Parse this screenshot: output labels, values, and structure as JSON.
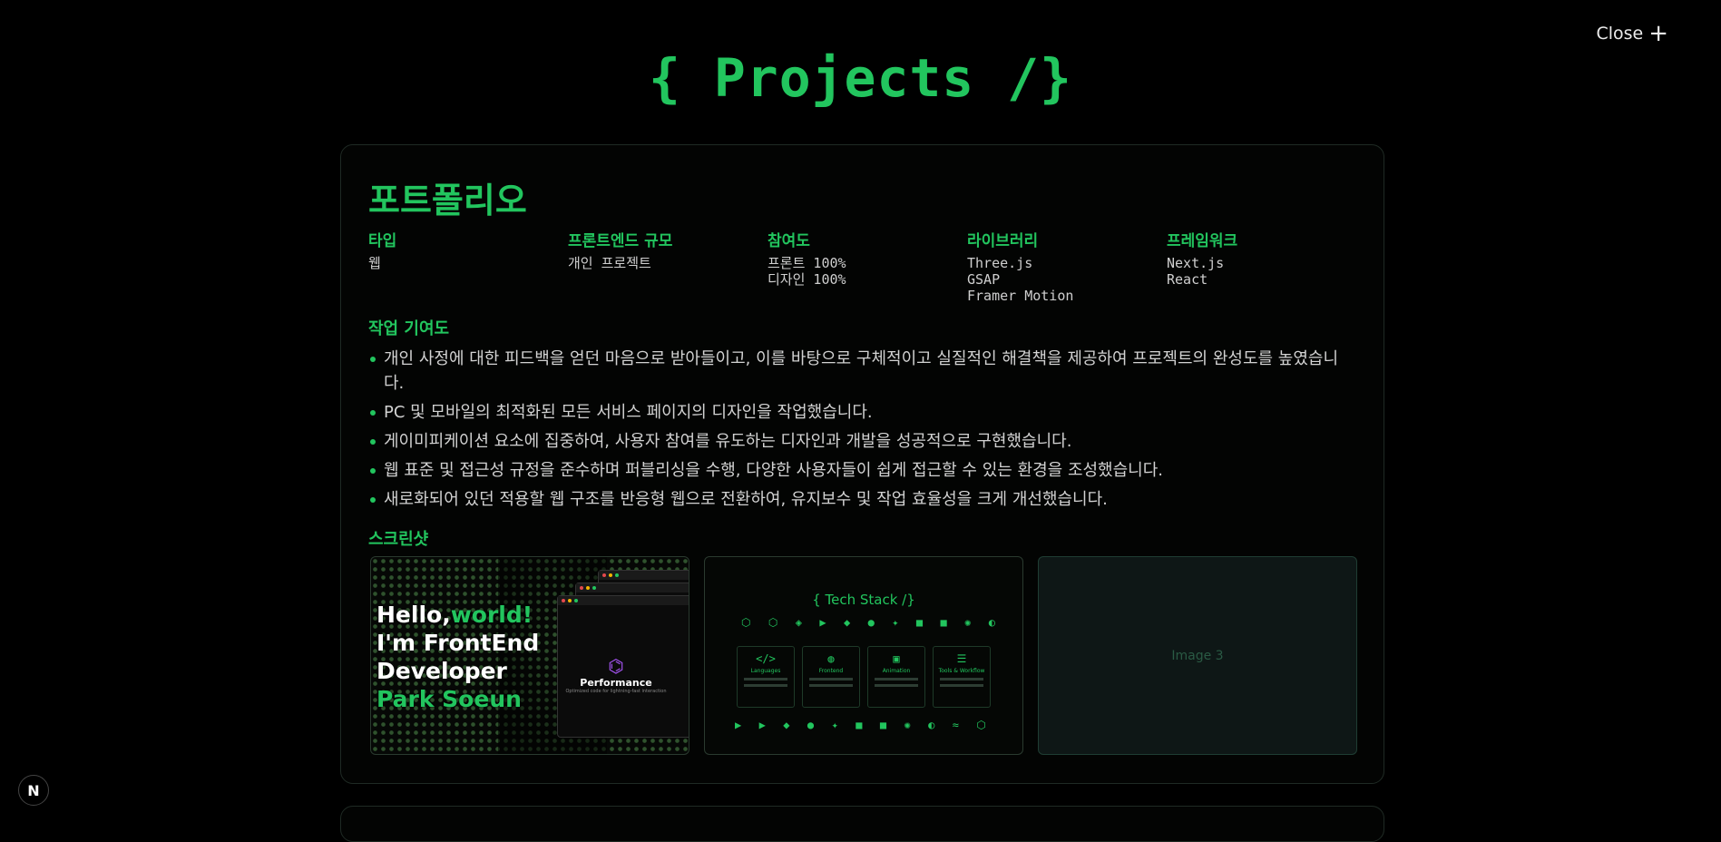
{
  "close_label": "Close",
  "page_title": "{ Projects /}",
  "project": {
    "title": "포트폴리오",
    "meta": [
      {
        "label": "타입",
        "values": [
          "웹"
        ]
      },
      {
        "label": "프론트엔드 규모",
        "values": [
          "개인 프로젝트"
        ]
      },
      {
        "label": "참여도",
        "values": [
          "프론트 100%",
          "디자인 100%"
        ]
      },
      {
        "label": "라이브러리",
        "values": [
          "Three.js",
          "GSAP",
          "Framer Motion"
        ]
      },
      {
        "label": "프레임워크",
        "values": [
          "Next.js",
          "React"
        ]
      }
    ],
    "contribution_heading": "작업 기여도",
    "contributions": [
      "개인 사정에 대한 피드백을 얻던 마음으로 받아들이고, 이를 바탕으로 구체적이고 실질적인 해결책을 제공하여 프로젝트의 완성도를 높였습니다.",
      "PC 및 모바일의 최적화된 모든 서비스 페이지의 디자인을 작업했습니다.",
      "게이미피케이션 요소에 집중하여, 사용자 참여를 유도하는 디자인과 개발을 성공적으로 구현했습니다.",
      "웹 표준 및 접근성 규정을 준수하며 퍼블리싱을 수행, 다양한 사용자들이 쉽게 접근할 수 있는 환경을 조성했습니다.",
      "새로화되어 있던 적용할 웹 구조를 반응형 웹으로 전환하여, 유지보수 및 작업 효율성을 크게 개선했습니다."
    ],
    "screenshots_heading": "스크린샷",
    "shot1": {
      "line1_white": "Hello,",
      "line1_green": "world!",
      "line2": "I'm FrontEnd",
      "line3": "Developer",
      "line4": "Park Soeun",
      "perf_title": "Performance",
      "perf_sub": "Optimized code for lightning-fast interaction"
    },
    "shot2": {
      "title": "{ Tech Stack /}",
      "boxes": [
        "Languages",
        "Frontend",
        "Animation",
        "Tools & Workflow"
      ]
    },
    "shot3_label": "Image 3"
  },
  "corner_logo": "N"
}
